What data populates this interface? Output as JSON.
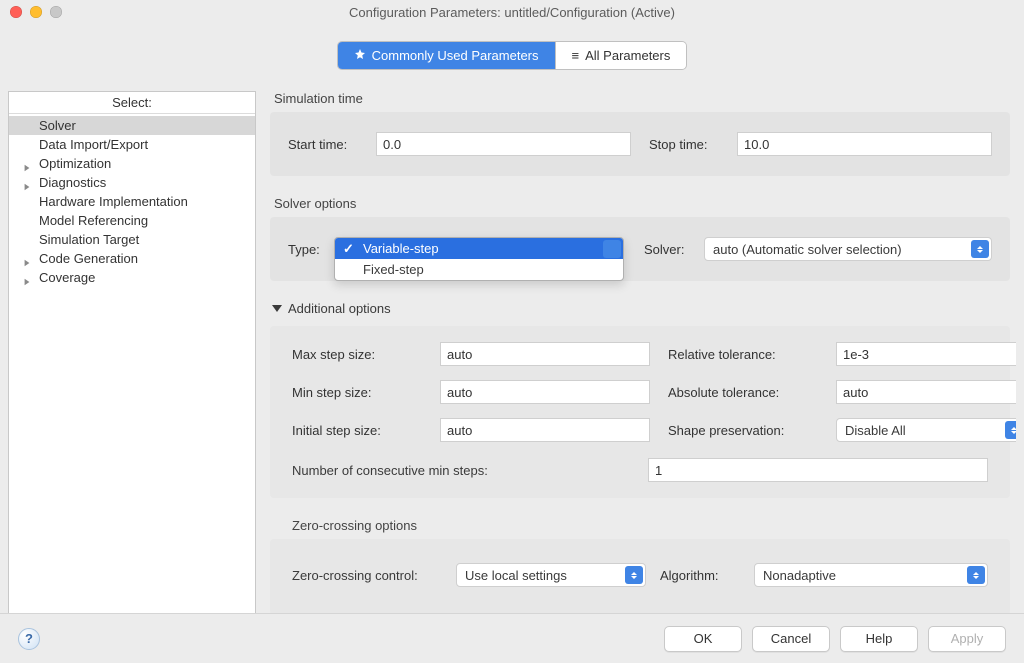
{
  "window_title": "Configuration Parameters: untitled/Configuration (Active)",
  "tabs": {
    "commonly_used": "Commonly Used Parameters",
    "all_parameters": "All Parameters"
  },
  "sidebar": {
    "header": "Select:",
    "items": [
      {
        "label": "Solver",
        "expandable": false,
        "selected": true
      },
      {
        "label": "Data Import/Export",
        "expandable": false
      },
      {
        "label": "Optimization",
        "expandable": true
      },
      {
        "label": "Diagnostics",
        "expandable": true
      },
      {
        "label": "Hardware Implementation",
        "expandable": false
      },
      {
        "label": "Model Referencing",
        "expandable": false
      },
      {
        "label": "Simulation Target",
        "expandable": false
      },
      {
        "label": "Code Generation",
        "expandable": true
      },
      {
        "label": "Coverage",
        "expandable": true
      }
    ]
  },
  "sim_time": {
    "title": "Simulation time",
    "start_label": "Start time:",
    "start_value": "0.0",
    "stop_label": "Stop time:",
    "stop_value": "10.0"
  },
  "solver_options": {
    "title": "Solver options",
    "type_label": "Type:",
    "type_options": [
      "Variable-step",
      "Fixed-step"
    ],
    "type_selected": "Variable-step",
    "solver_label": "Solver:",
    "solver_value": "auto (Automatic solver selection)"
  },
  "additional": {
    "title": "Additional options",
    "max_step_label": "Max step size:",
    "max_step_value": "auto",
    "min_step_label": "Min step size:",
    "min_step_value": "auto",
    "initial_step_label": "Initial step size:",
    "initial_step_value": "auto",
    "rel_tol_label": "Relative tolerance:",
    "rel_tol_value": "1e-3",
    "abs_tol_label": "Absolute tolerance:",
    "abs_tol_value": "auto",
    "shape_label": "Shape preservation:",
    "shape_value": "Disable All",
    "consec_label": "Number of consecutive min steps:",
    "consec_value": "1"
  },
  "zero_crossing": {
    "title": "Zero-crossing options",
    "control_label": "Zero-crossing control:",
    "control_value": "Use local settings",
    "algo_label": "Algorithm:",
    "algo_value": "Nonadaptive"
  },
  "buttons": {
    "ok": "OK",
    "cancel": "Cancel",
    "help": "Help",
    "apply": "Apply"
  }
}
